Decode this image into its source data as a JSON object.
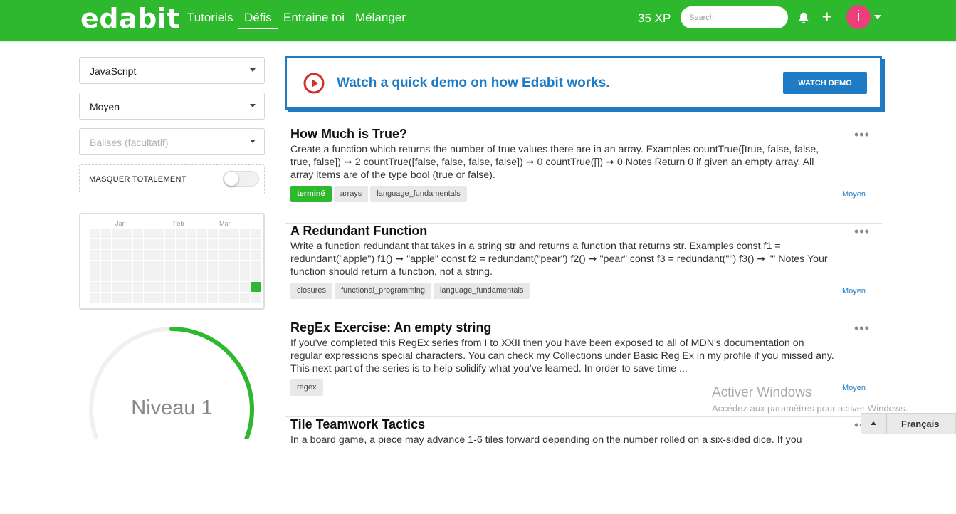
{
  "header": {
    "logo": "edabit",
    "nav": [
      {
        "label": "Tutoriels",
        "active": false
      },
      {
        "label": "Défis",
        "active": true
      },
      {
        "label": "Entraine toi",
        "active": false
      },
      {
        "label": "Mélanger",
        "active": false
      }
    ],
    "xp": "35 XP",
    "search_placeholder": "Search",
    "bell_icon": "bell-icon",
    "plus_label": "+",
    "avatar_letter": "i",
    "brand_color": "#2eb82e"
  },
  "filters": {
    "language": "JavaScript",
    "difficulty": "Moyen",
    "tags_placeholder": "Balises (facultatif)",
    "hide_label": "MASQUER TOTALEMENT",
    "hide_enabled": false
  },
  "activity": {
    "months": [
      "Jan",
      "Feb",
      "Mar"
    ],
    "active_color": "#2eb82e"
  },
  "level": {
    "label": "Niveau 1",
    "progress": 0.62
  },
  "demo": {
    "text": "Watch a quick demo on how Edabit works.",
    "button": "WATCH DEMO",
    "accent": "#1e7bc4"
  },
  "challenges": [
    {
      "title": "How Much is True?",
      "description": "Create a function which returns the number of true values there are in an array. Examples countTrue([true, false, false, true, false]) ➞ 2 countTrue([false, false, false, false]) ➞ 0 countTrue([]) ➞ 0 Notes Return 0 if given an empty array. All array items are of the type bool (true or false).",
      "tags": [
        {
          "label": "terminé",
          "done": true
        },
        {
          "label": "arrays",
          "done": false
        },
        {
          "label": "language_fundamentals",
          "done": false
        }
      ],
      "difficulty": "Moyen",
      "menu": "•••"
    },
    {
      "title": "A Redundant Function",
      "description": "Write a function redundant that takes in a string str and returns a function that returns str. Examples const f1 = redundant(\"apple\") f1() ➞ \"apple\" const f2 = redundant(\"pear\") f2() ➞ \"pear\" const f3 = redundant(\"\") f3() ➞ \"\" Notes Your function should return a function, not a string.",
      "tags": [
        {
          "label": "closures",
          "done": false
        },
        {
          "label": "functional_programming",
          "done": false
        },
        {
          "label": "language_fundamentals",
          "done": false
        }
      ],
      "difficulty": "Moyen",
      "menu": "•••"
    },
    {
      "title": "RegEx Exercise: An empty string",
      "description": "If you've completed this RegEx series from I to XXII then you have been exposed to all of MDN's documentation on regular expressions special characters. You can check my Collections under Basic Reg Ex in my profile if you missed any. This next part of the series is to help solidify what you've learned. In order to save time ...",
      "tags": [
        {
          "label": "regex",
          "done": false
        }
      ],
      "difficulty": "Moyen",
      "menu": "•••"
    },
    {
      "title": "Tile Teamwork Tactics",
      "description": "In a board game, a piece may advance 1-6 tiles forward depending on the number rolled on a six-sided dice. If you",
      "tags": [],
      "difficulty": "",
      "menu": "•••"
    }
  ],
  "windows_watermark": {
    "line1": "Activer Windows",
    "line2": "Accédez aux paramètres pour activer Windows."
  },
  "language_switcher": {
    "label": "Français"
  }
}
